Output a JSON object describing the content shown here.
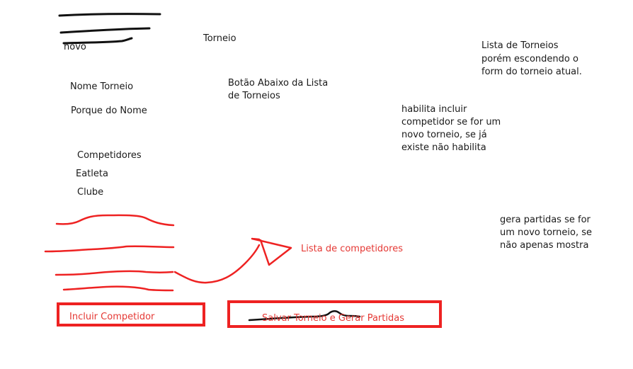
{
  "sketch": {
    "top_left": {
      "novo": "novo"
    },
    "torneio_title": "Torneio",
    "form_fields": [
      "Nome Torneio",
      "Porque do Nome"
    ],
    "competitor_fields": [
      "Competidores",
      "Eatleta",
      "Clube"
    ],
    "note_button_below": [
      "Botão Abaixo da Lista",
      "de Torneios"
    ],
    "note_tournament_list": [
      "Lista de Torneios",
      "porém escondendo o",
      "form do torneio atual."
    ],
    "note_enable_include": [
      "habilita incluir",
      "competidor se for um",
      "novo torneio, se já",
      "existe não habilita"
    ],
    "note_generate_matches": [
      "gera partidas se for",
      "um novo torneio, se",
      "não apenas mostra"
    ],
    "competitor_list_label": "Lista de competidores",
    "include_button": "Incluir Competidor",
    "save_button": "Salvar Torneio e Gerar Partidas",
    "colors": {
      "ink_black": "#111111",
      "ink_red": "#ee2222",
      "text": "#1a1a1a",
      "text_red": "#e53935"
    }
  }
}
